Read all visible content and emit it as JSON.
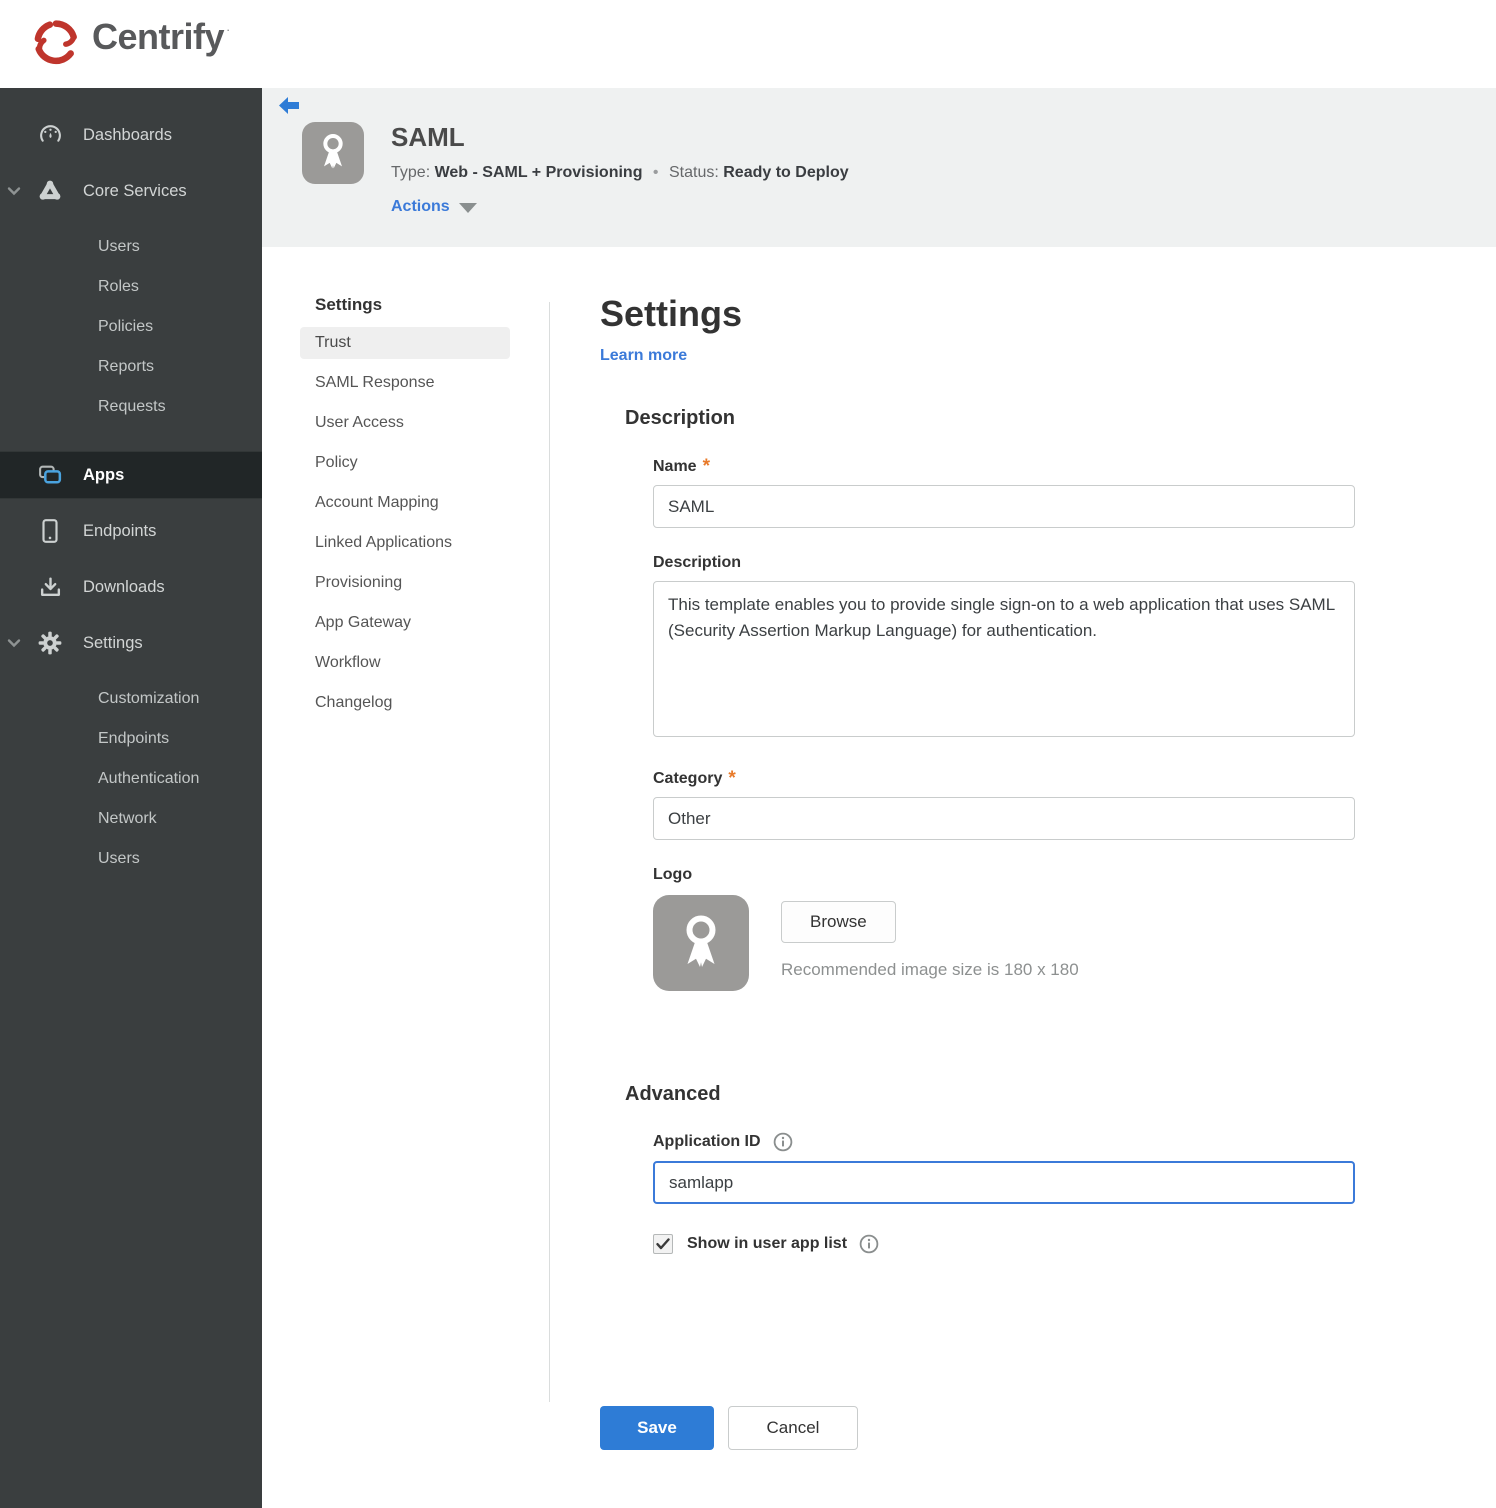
{
  "brand": {
    "name": "Centrify",
    "mark": "·"
  },
  "colors": {
    "accent_blue": "#2e7cd6",
    "link_blue": "#3b7ad9",
    "status_red": "#a41e22",
    "required_orange": "#e87a2a",
    "sidebar_bg": "#3a3e3f",
    "header_bg": "#eff1f1"
  },
  "sidebar": {
    "items": [
      {
        "label": "Dashboards"
      },
      {
        "label": "Core Services"
      },
      {
        "label": "Users"
      },
      {
        "label": "Roles"
      },
      {
        "label": "Policies"
      },
      {
        "label": "Reports"
      },
      {
        "label": "Requests"
      },
      {
        "label": "Apps",
        "selected": true
      },
      {
        "label": "Endpoints"
      },
      {
        "label": "Downloads"
      },
      {
        "label": "Settings"
      },
      {
        "label": "Customization"
      },
      {
        "label": "Endpoints"
      },
      {
        "label": "Authentication"
      },
      {
        "label": "Network"
      },
      {
        "label": "Users"
      }
    ]
  },
  "app_header": {
    "title": "SAML",
    "type_label": "Type:",
    "type_value": "Web - SAML + Provisioning",
    "separator": "•",
    "status_label": "Status:",
    "status_value": "Ready to Deploy",
    "actions_label": "Actions"
  },
  "subnav": {
    "header": "Settings",
    "items": [
      {
        "label": "Trust",
        "selected": true
      },
      {
        "label": "SAML Response"
      },
      {
        "label": "User Access"
      },
      {
        "label": "Policy"
      },
      {
        "label": "Account Mapping"
      },
      {
        "label": "Linked Applications"
      },
      {
        "label": "Provisioning"
      },
      {
        "label": "App Gateway"
      },
      {
        "label": "Workflow"
      },
      {
        "label": "Changelog"
      }
    ]
  },
  "form": {
    "title": "Settings",
    "learn_more": "Learn more",
    "sections": {
      "description": "Description",
      "advanced": "Advanced"
    },
    "fields": {
      "name": {
        "label": "Name",
        "required": "*",
        "value": "SAML"
      },
      "description": {
        "label": "Description",
        "value": "This template enables you to provide single sign-on to a web application that uses SAML (Security Assertion Markup Language) for authentication."
      },
      "category": {
        "label": "Category",
        "required": "*",
        "value": "Other"
      },
      "logo": {
        "label": "Logo",
        "browse_label": "Browse",
        "hint": "Recommended image size is 180 x 180"
      },
      "application_id": {
        "label": "Application ID",
        "value": "samlapp"
      },
      "show_in_user_app_list": {
        "label": "Show in user app list",
        "checked": true
      }
    },
    "buttons": {
      "save": "Save",
      "cancel": "Cancel"
    }
  }
}
